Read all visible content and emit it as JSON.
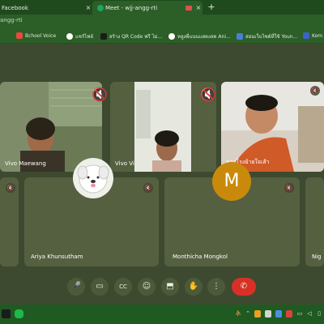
{
  "browser": {
    "tabs": [
      {
        "label": "Facebook",
        "close": "×"
      },
      {
        "label": "Meet - wjj-angg-rti",
        "close": "×"
      }
    ],
    "new_tab": "+",
    "address": "angg-rti"
  },
  "bookmarks": [
    {
      "label": "Bchool Voice"
    },
    {
      "label": "แชร์ไฟล์"
    },
    {
      "label": "สร้าง QR Code ฟรี ไม่..."
    },
    {
      "label": "หลูงพี่แนนแสดงสด Ani..."
    },
    {
      "label": "สอนเว็บไซต์ที่ใช้ Youn..."
    },
    {
      "label": "Kom"
    }
  ],
  "participants": [
    {
      "name": "Vivo Maewang",
      "muted": true
    },
    {
      "name": "Vivo Vi",
      "muted": false
    },
    {
      "name": "ด่าวโรงย้ายใจเส้า",
      "muted": true
    },
    {
      "name": "",
      "muted": true
    },
    {
      "name": "Ariya Khunsutham",
      "muted": true
    },
    {
      "name": "Monthicha Mongkol",
      "muted": true,
      "initial": "M"
    },
    {
      "name": "Nig",
      "muted": false
    }
  ],
  "controls": [
    {
      "name": "microphone",
      "glyph": "🎤"
    },
    {
      "name": "camera",
      "glyph": "▭"
    },
    {
      "name": "captions",
      "glyph": "CC"
    },
    {
      "name": "emoji",
      "glyph": "☺"
    },
    {
      "name": "present",
      "glyph": "⬒"
    },
    {
      "name": "raise-hand",
      "glyph": "✋"
    },
    {
      "name": "more-options",
      "glyph": "⋮"
    },
    {
      "name": "leave-call",
      "glyph": "✆"
    }
  ],
  "colors": {
    "tabbar": "#1f4a1d",
    "toolbar": "#2c5e28",
    "meet_bg": "#3d4a2f",
    "tile": "#556040",
    "hangup": "#d93025",
    "avatar_m": "#c98a0b"
  }
}
